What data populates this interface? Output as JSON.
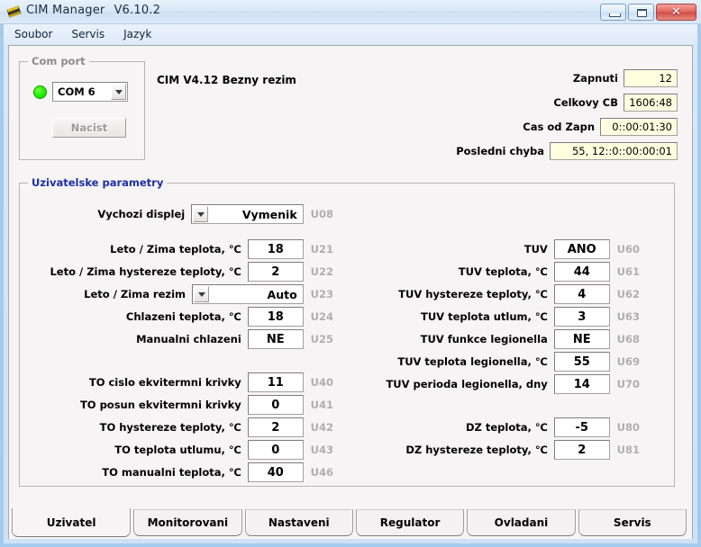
{
  "window": {
    "title": "CIM Manager",
    "version": "V6.10.2",
    "icon": "chip-icon",
    "minimize_label": "",
    "maximize_label": "",
    "close_label": "✕"
  },
  "menubar": {
    "items": [
      {
        "label": "Soubor"
      },
      {
        "label": "Servis"
      },
      {
        "label": "Jazyk"
      }
    ]
  },
  "comport": {
    "title": "Com port",
    "led_color": "#22f500",
    "port_value": "COM 6",
    "load_button": "Nacist"
  },
  "device": {
    "info": "CIM V4.12  Bezny rezim"
  },
  "status": {
    "rows": [
      {
        "label": "Zapnuti",
        "value": "12"
      },
      {
        "label": "Celkovy CB",
        "value": "1606:48"
      },
      {
        "label": "Cas od Zapn",
        "value": "0::00:01:30"
      },
      {
        "label": "Posledni chyba",
        "value": "55, 12::0::00:00:01"
      }
    ]
  },
  "userparams": {
    "title": "Uzivatelske parametry",
    "display_row": {
      "label": "Vychozi displej",
      "value": "Vymenik",
      "code": "U08",
      "type": "combo"
    },
    "left_rows": [
      {
        "label": "Leto / Zima teplota, ℃",
        "value": "18",
        "code": "U21",
        "type": "field"
      },
      {
        "label": "Leto / Zima hystereze teploty, ℃",
        "value": "2",
        "code": "U22",
        "type": "field"
      },
      {
        "label": "Leto / Zima rezim",
        "value": "Auto",
        "code": "U23",
        "type": "combo"
      },
      {
        "label": "Chlazeni teplota, ℃",
        "value": "18",
        "code": "U24",
        "type": "field"
      },
      {
        "label": "Manualni chlazeni",
        "value": "NE",
        "code": "U25",
        "type": "field"
      }
    ],
    "left_rows2": [
      {
        "label": "TO cislo ekvitermni krivky",
        "value": "11",
        "code": "U40",
        "type": "field"
      },
      {
        "label": "TO posun ekvitermni krivky",
        "value": "0",
        "code": "U41",
        "type": "field"
      },
      {
        "label": "TO hystereze teploty, ℃",
        "value": "2",
        "code": "U42",
        "type": "field"
      },
      {
        "label": "TO teplota utlumu, ℃",
        "value": "0",
        "code": "U43",
        "type": "field"
      },
      {
        "label": "TO manualni teplota, ℃",
        "value": "40",
        "code": "U46",
        "type": "field"
      }
    ],
    "right_rows": [
      {
        "label": "TUV",
        "value": "ANO",
        "code": "U60",
        "type": "field"
      },
      {
        "label": "TUV teplota, ℃",
        "value": "44",
        "code": "U61",
        "type": "field"
      },
      {
        "label": "TUV hystereze teploty, ℃",
        "value": "4",
        "code": "U62",
        "type": "field"
      },
      {
        "label": "TUV teplota utlum, ℃",
        "value": "3",
        "code": "U63",
        "type": "field"
      },
      {
        "label": "TUV funkce legionella",
        "value": "NE",
        "code": "U68",
        "type": "field"
      },
      {
        "label": "TUV teplota legionella, ℃",
        "value": "55",
        "code": "U69",
        "type": "field"
      },
      {
        "label": "TUV perioda legionella, dny",
        "value": "14",
        "code": "U70",
        "type": "field"
      }
    ],
    "right_rows2": [
      {
        "label": "DZ teplota, ℃",
        "value": "-5",
        "code": "U80",
        "type": "field"
      },
      {
        "label": "DZ hystereze teploty, ℃",
        "value": "2",
        "code": "U81",
        "type": "field"
      }
    ]
  },
  "tabs": {
    "active_index": 0,
    "items": [
      {
        "label": "Uzivatel"
      },
      {
        "label": "Monitorovani"
      },
      {
        "label": "Nastaveni"
      },
      {
        "label": "Regulator"
      },
      {
        "label": "Ovladani"
      },
      {
        "label": "Servis"
      }
    ]
  }
}
